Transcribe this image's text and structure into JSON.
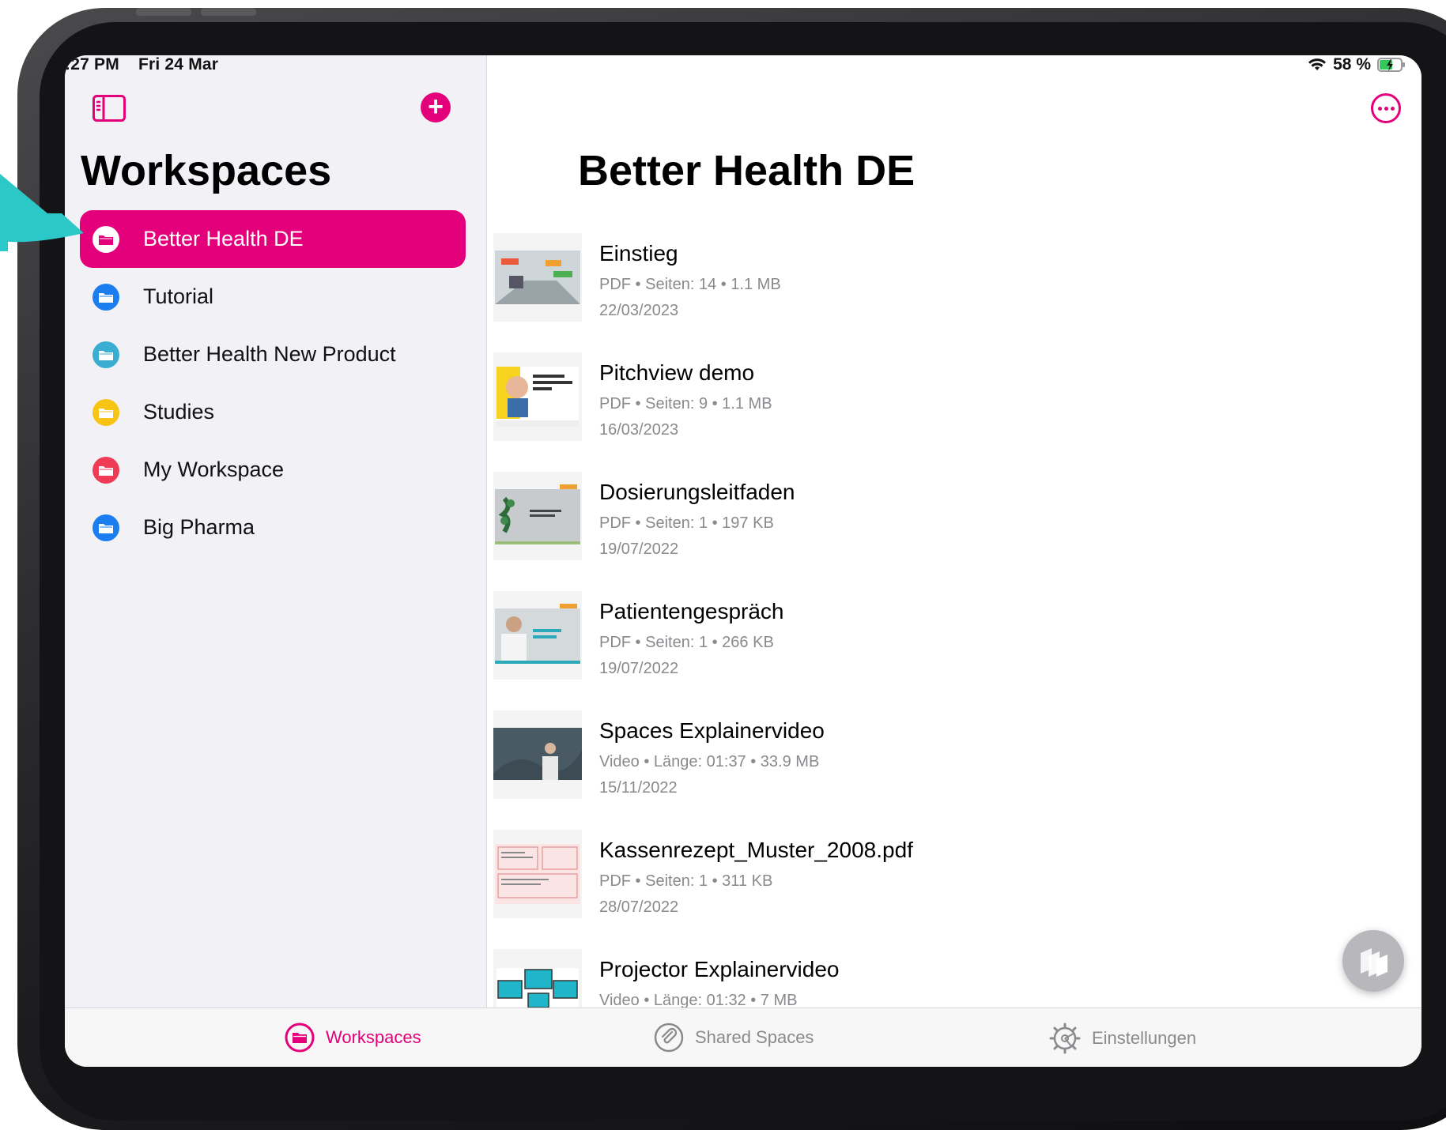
{
  "status_bar": {
    "time": ":27 PM",
    "date": "Fri 24 Mar",
    "battery": "58 %"
  },
  "sidebar": {
    "title": "Workspaces",
    "items": [
      {
        "label": "Better Health DE",
        "color": "#e4007b",
        "active": true
      },
      {
        "label": "Tutorial",
        "color": "#1a7ef0",
        "active": false
      },
      {
        "label": "Better Health New Product",
        "color": "#3aaed1",
        "active": false
      },
      {
        "label": "Studies",
        "color": "#f7c414",
        "active": false
      },
      {
        "label": "My Workspace",
        "color": "#ef3b55",
        "active": false
      },
      {
        "label": "Big Pharma",
        "color": "#1a7ef0",
        "active": false
      }
    ]
  },
  "main": {
    "title": "Better Health DE",
    "documents": [
      {
        "name": "Einstieg",
        "meta": "PDF • Seiten: 14 • 1.1 MB",
        "date": "22/03/2023"
      },
      {
        "name": "Pitchview demo",
        "meta": "PDF • Seiten: 9 • 1.1 MB",
        "date": "16/03/2023"
      },
      {
        "name": "Dosierungsleitfaden",
        "meta": "PDF • Seiten: 1 • 197 KB",
        "date": "19/07/2022"
      },
      {
        "name": "Patientengespräch",
        "meta": "PDF • Seiten: 1 • 266 KB",
        "date": "19/07/2022"
      },
      {
        "name": "Spaces Explainervideo",
        "meta": "Video • Länge: 01:37 • 33.9 MB",
        "date": "15/11/2022"
      },
      {
        "name": "Kassenrezept_Muster_2008.pdf",
        "meta": "PDF • Seiten: 1 • 311 KB",
        "date": "28/07/2022"
      },
      {
        "name": "Projector Explainervideo",
        "meta": "Video • Länge: 01:32 • 7 MB",
        "date": ""
      }
    ]
  },
  "tabbar": {
    "tabs": [
      {
        "label": "Workspaces",
        "active": true
      },
      {
        "label": "Shared Spaces",
        "active": false
      },
      {
        "label": "Einstellungen",
        "active": false
      }
    ]
  },
  "colors": {
    "accent": "#e4007b",
    "annotation_arrow": "#2cc8c8"
  }
}
